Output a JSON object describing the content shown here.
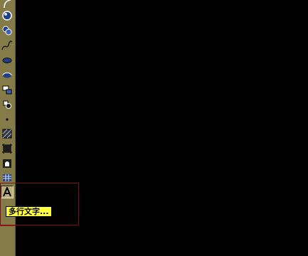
{
  "colors": {
    "toolbar_bg": "#857b48",
    "canvas_bg": "#000000",
    "tooltip_bg": "#ffff3b",
    "selection_border": "#7a1016"
  },
  "toolbar": {
    "tools": [
      {
        "name": "arc-icon"
      },
      {
        "name": "circle-icon"
      },
      {
        "name": "revision-cloud-icon"
      },
      {
        "name": "spline-icon"
      },
      {
        "name": "ellipse-icon"
      },
      {
        "name": "ellipse-arc-icon"
      },
      {
        "name": "insert-block-icon"
      },
      {
        "name": "make-block-icon"
      },
      {
        "name": "point-icon"
      },
      {
        "name": "hatch-icon"
      },
      {
        "name": "gradient-icon"
      },
      {
        "name": "region-icon"
      },
      {
        "name": "table-icon"
      },
      {
        "name": "multiline-text-icon",
        "active": true
      }
    ]
  },
  "tooltip": {
    "text": "多行文字..."
  }
}
